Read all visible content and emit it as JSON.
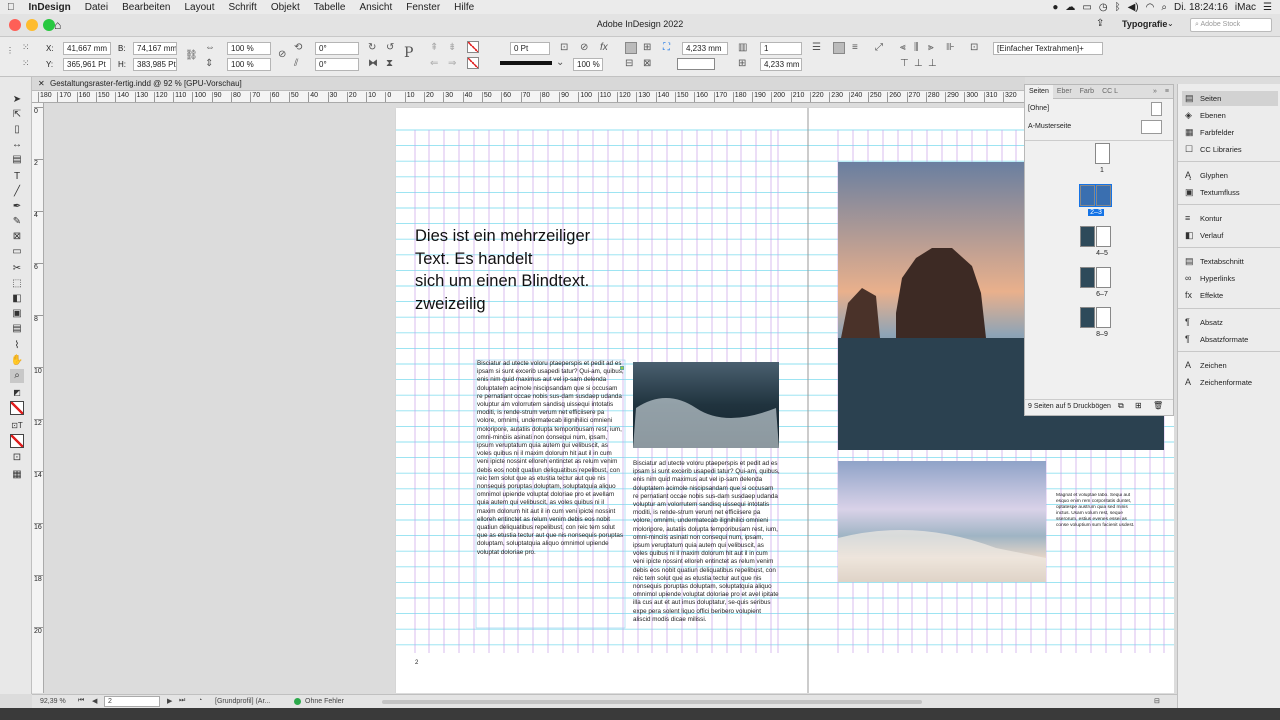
{
  "menubar": {
    "app": "InDesign",
    "items": [
      "Datei",
      "Bearbeiten",
      "Layout",
      "Schrift",
      "Objekt",
      "Tabelle",
      "Ansicht",
      "Fenster",
      "Hilfe"
    ],
    "clock": "Di. 18:24:16",
    "machine": "iMac"
  },
  "titlebar": {
    "title": "Adobe InDesign 2022",
    "workspace": "Typografie",
    "stock_placeholder": "Adobe Stock"
  },
  "control": {
    "x_label": "X:",
    "x_value": "41,667 mm",
    "y_label": "Y:",
    "y_value": "365,961 Pt",
    "b_label": "B:",
    "b_value": "74,167 mm",
    "h_label": "H:",
    "h_value": "383,985 Pt",
    "scale_x": "100 %",
    "scale_y": "100 %",
    "angle": "0°",
    "shear": "0°",
    "stroke_weight": "0 Pt",
    "opacity": "100 %",
    "offset_1": "4,233 mm",
    "offset_2": "4,233 mm",
    "columns": "1",
    "style": "[Einfacher Textrahmen]+"
  },
  "doctab": {
    "label": "Gestaltungsraster-fertig.indd @ 92 % [GPU-Vorschau]"
  },
  "hruler": [
    "180",
    "170",
    "160",
    "150",
    "140",
    "130",
    "120",
    "110",
    "100",
    "90",
    "80",
    "70",
    "60",
    "50",
    "40",
    "30",
    "20",
    "10",
    "0",
    "10",
    "20",
    "30",
    "40",
    "50",
    "60",
    "70",
    "80",
    "90",
    "100",
    "110",
    "120",
    "130",
    "140",
    "150",
    "160",
    "170",
    "180",
    "190",
    "200",
    "210",
    "220",
    "230",
    "240",
    "250",
    "260",
    "270",
    "280",
    "290",
    "300",
    "310",
    "320"
  ],
  "vruler": [
    "0",
    "2",
    "4",
    "6",
    "8",
    "10",
    "12",
    "14",
    "16",
    "18",
    "20"
  ],
  "document": {
    "headline": "Dies ist ein mehrzeiliger\nText. Es handelt\nsich um einen Blindtext.\nzweizeilig",
    "text_a": "Bisciatur ad utecte voloru ptaeperspis et pedit ad es ipsam si sunt excerib usapedi tatur? Qui-am, quibus, enis nim quid maximus aut vel ip-sam delenda doluptatem acimole niscipsandam que si occusam re pernatiant occae nobis sus-dam susdaep udanda voluptur am volorrutem sandisq uissequi intotatis moditi, is rende-strum verum net efficiisere pa volore, omnimi, undermatecab ilignihilici omnieni moloripore, autatiis dolupta temporibusam rest, ium, omni-minciis asinati non consequi num, ipsam, ipsum veruptatum quia autem qui velibuscit, as voles quibus ni il maxim dolorum hit aut il in cum veni ipicte nossint elloreh entinctet as relum venim debis eos nobit quatiun deliquatibus repelibust, con reic tem solut que as etustia tectur aut que nis nonsequis poruptas doluptam, soluptatquia aliquo omnimol upiende voluptat doloriae pro et avellam quia autem qui velibuscit, as voles quibus ni il maxim dolorum hit aut il in cum veni ipicte nossint elloreh entinctet as relum venim debis eos nobit quatiun deliquatibus repelibust, con reic tem solut que as etustia tectur aut que nis nonsequis poruptas doluptam, soluptatquia aliquo omnimol upiende voluptat doloriae pro.",
    "text_b": "Bisciatur ad utecte voloru ptaeperspis et pedit ad es ipsam si sunt excerib usapedi tatur? Qui-am, quibus, enis nim quid maximus aut vel ip-sam delenda doluptatem acimole niscipsandam que si occusam re pernatiant occae nobis sus-dam susdaep udanda voluptur am volorrutem sandisq uissequi intotatis moditi, is rende-strum verum net efficiisere pa volore, omnimi, undermatecab ilignihilici omnieni moloripore, autatiis dolupta temporibusam rest, ium, omni-minciis asinati non consequi num, ipsam, ipsum veruptatum quia autem qui velibuscit, as voles quibus ni il maxim dolorum hit aut il in cum veni ipicte nossint elloreh entinctet as relum venim debis eos nobit quatiun deliquatibus repelibust, con reic tem solut que as etustia tectur aut que nis nonsequis poruptas doluptam, soluptatquia aliquo omnimol upiende voluptat doloriae pro et avel ipitate illa cus aut et aut imus doluptatur, se-quis seribus expe pera solent liquo offici beribero volupient aliscid modis dicae milissi.",
    "text_c": "Magnat et voluptae labo. Sequi aut esquo enim rem corporitatis duntet, optatespe austrum quia sed minis inctus. Usam volum rest, seque sserorum, estius evenes essei as conse voluptium sum facienit usdest.",
    "page_number": "2"
  },
  "status": {
    "zoom": "92,39 %",
    "page": "2",
    "profile": "[Grundprofil] (Ar...",
    "preflight": "Ohne Fehler"
  },
  "pages_panel": {
    "tabs": [
      "Seiten",
      "Eber",
      "Farb",
      "CC L"
    ],
    "none_label": "[Ohne]",
    "master_label": "A-Musterseite",
    "page_labels": [
      "1",
      "2–3",
      "4–5",
      "6–7",
      "8–9"
    ],
    "footer": "9 Seiten auf 5 Druckbögen"
  },
  "dock": {
    "items": [
      {
        "label": "Seiten",
        "icon": "▤"
      },
      {
        "label": "Ebenen",
        "icon": "◈"
      },
      {
        "label": "Farbfelder",
        "icon": "▦"
      },
      {
        "label": "CC Libraries",
        "icon": "☐"
      },
      {
        "label": "Glyphen",
        "icon": "Ą"
      },
      {
        "label": "Textumfluss",
        "icon": "▣"
      },
      {
        "label": "Kontur",
        "icon": "≡"
      },
      {
        "label": "Verlauf",
        "icon": "◧"
      },
      {
        "label": "Textabschnitt",
        "icon": "▤"
      },
      {
        "label": "Hyperlinks",
        "icon": "∞"
      },
      {
        "label": "Effekte",
        "icon": "fx"
      },
      {
        "label": "Absatz",
        "icon": "¶"
      },
      {
        "label": "Absatzformate",
        "icon": "¶"
      },
      {
        "label": "Zeichen",
        "icon": "A"
      },
      {
        "label": "Zeichenformate",
        "icon": "A"
      }
    ]
  },
  "colors": {
    "margin": "#c8a0e8",
    "grid": "#8fe0f0",
    "accent": "#1473e6"
  }
}
